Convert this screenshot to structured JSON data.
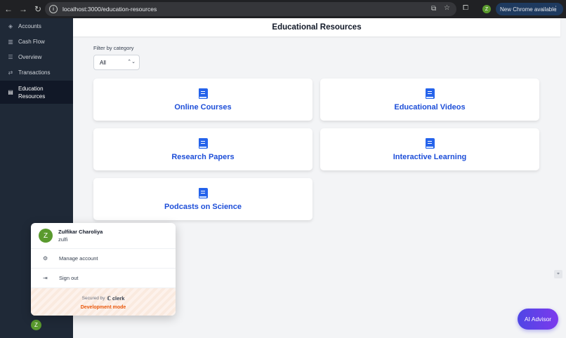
{
  "browser": {
    "url": "localhost:3000/education-resources",
    "profile_initial": "Z",
    "new_chrome_label": "New Chrome available"
  },
  "sidebar": {
    "items": [
      {
        "label": "Accounts",
        "icon": "layers-icon"
      },
      {
        "label": "Cash Flow",
        "icon": "bar-chart-icon"
      },
      {
        "label": "Overview",
        "icon": "list-icon"
      },
      {
        "label": "Transactions",
        "icon": "swap-icon"
      },
      {
        "label": "Education Resources",
        "icon": "book-icon",
        "active": true
      }
    ],
    "avatar_initial": "Z"
  },
  "main": {
    "title": "Educational Resources",
    "filter_label": "Filter by category",
    "filter_value": "All",
    "cards": [
      {
        "title": "Online Courses"
      },
      {
        "title": "Educational Videos"
      },
      {
        "title": "Research Papers"
      },
      {
        "title": "Interactive Learning"
      },
      {
        "title": "Podcasts on Science"
      }
    ]
  },
  "user_popover": {
    "avatar_initial": "Z",
    "name": "Zulfikar Charoliya",
    "handle": "zulfi",
    "manage_label": "Manage account",
    "signout_label": "Sign out",
    "secured_by": "Secured by",
    "brand": "clerk",
    "dev_mode": "Development mode"
  },
  "ai_advisor_label": "AI Advisor",
  "colors": {
    "sidebar_bg": "#1f2937",
    "accent": "#1d4ed8",
    "dev_mode": "#ea580c",
    "avatar_green": "#5a9a2e"
  }
}
